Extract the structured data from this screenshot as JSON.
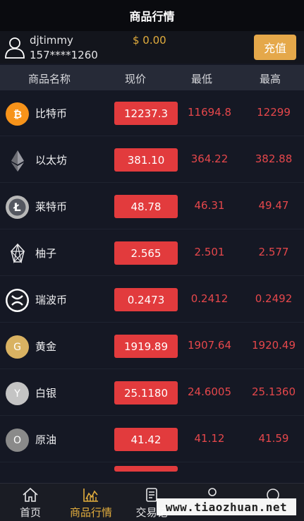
{
  "header": {
    "title": "商品行情"
  },
  "account": {
    "username": "djtimmy",
    "phone": "157****1260",
    "balance": "$ 0.00",
    "recharge_label": "充值"
  },
  "columns": {
    "name": "商品名称",
    "price": "现价",
    "low": "最低",
    "high": "最高"
  },
  "rows": [
    {
      "name": "比特币",
      "price": "12237.3",
      "low": "11694.8",
      "high": "12299",
      "icon": "bitcoin-icon",
      "icon_color": "#f7931a"
    },
    {
      "name": "以太坊",
      "price": "381.10",
      "low": "364.22",
      "high": "382.88",
      "icon": "ethereum-icon",
      "icon_color": "#1c1e27"
    },
    {
      "name": "莱特币",
      "price": "48.78",
      "low": "46.31",
      "high": "49.47",
      "icon": "litecoin-icon",
      "icon_color": "#b8b8b8"
    },
    {
      "name": "柚子",
      "price": "2.565",
      "low": "2.501",
      "high": "2.577",
      "icon": "eos-icon",
      "icon_color": "#1c1e27"
    },
    {
      "name": "瑞波币",
      "price": "0.2473",
      "low": "0.2412",
      "high": "0.2492",
      "icon": "ripple-icon",
      "icon_color": "#ffffff"
    },
    {
      "name": "黄金",
      "price": "1919.89",
      "low": "1907.64",
      "high": "1920.49",
      "icon": "gold-icon",
      "icon_color": "#d9b262",
      "letter": "G"
    },
    {
      "name": "白银",
      "price": "25.1180",
      "low": "24.6005",
      "high": "25.1360",
      "icon": "silver-icon",
      "icon_color": "#c4c4c4",
      "letter": "Y"
    },
    {
      "name": "原油",
      "price": "41.42",
      "low": "41.12",
      "high": "41.59",
      "icon": "oil-icon",
      "icon_color": "#8a8a8a",
      "letter": "O"
    }
  ],
  "tabs": [
    {
      "label": "首页",
      "icon": "home-icon"
    },
    {
      "label": "商品行情",
      "icon": "chart-icon",
      "active": true
    },
    {
      "label": "交易记",
      "icon": "record-icon"
    },
    {
      "label": "",
      "icon": "user-icon"
    },
    {
      "label": "",
      "icon": "service-icon"
    }
  ],
  "watermark": "www.tiaozhuan.net",
  "colors": {
    "accent": "#e2ad3d",
    "price_bg": "#e23b3d",
    "down": "#e5474b"
  }
}
